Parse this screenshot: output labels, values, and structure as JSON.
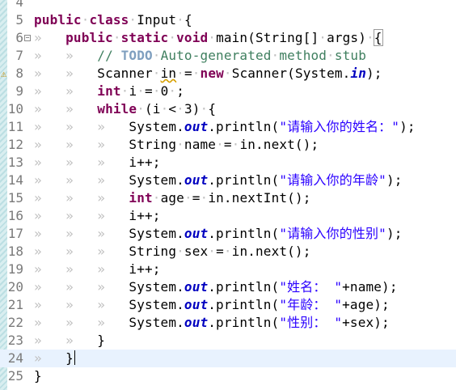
{
  "editor": {
    "lines": [
      {
        "num": "4",
        "code": ""
      },
      {
        "num": "5",
        "code": "public class Input {"
      },
      {
        "num": "6",
        "code": "    public static void main(String[] args) {"
      },
      {
        "num": "7",
        "code": "        // TODO Auto-generated method stub"
      },
      {
        "num": "8",
        "code": "        Scanner in = new Scanner(System.in);"
      },
      {
        "num": "9",
        "code": "        int i = 0 ;"
      },
      {
        "num": "10",
        "code": "        while (i < 3) {"
      },
      {
        "num": "11",
        "code": "            System.out.println(\"请输入你的姓名：\");"
      },
      {
        "num": "12",
        "code": "            String name = in.next();"
      },
      {
        "num": "13",
        "code": "            i++;"
      },
      {
        "num": "14",
        "code": "            System.out.println(\"请输入你的年龄\");"
      },
      {
        "num": "15",
        "code": "            int age = in.nextInt();"
      },
      {
        "num": "16",
        "code": "            i++;"
      },
      {
        "num": "17",
        "code": "            System.out.println(\"请输入你的性别\");"
      },
      {
        "num": "18",
        "code": "            String sex = in.next();"
      },
      {
        "num": "19",
        "code": "            i++;"
      },
      {
        "num": "20",
        "code": "            System.out.println(\"姓名： \"+name);"
      },
      {
        "num": "21",
        "code": "            System.out.println(\"年龄： \"+age);"
      },
      {
        "num": "22",
        "code": "            System.out.println(\"性别： \"+sex);"
      },
      {
        "num": "23",
        "code": "        }"
      },
      {
        "num": "24",
        "code": "    }"
      },
      {
        "num": "25",
        "code": "}"
      }
    ],
    "current_line": "24",
    "fold_marker_line": "6",
    "warning_line": "8",
    "colors": {
      "keyword": "#7f0055",
      "comment": "#3f7f5f",
      "todo": "#7f9fbf",
      "string": "#2a00ff",
      "field": "#0000c0",
      "current_line_bg": "#e8f2fe"
    },
    "icons": {
      "fold": "fold-collapse-icon",
      "warning": "warning-icon",
      "override": "override-marker-icon"
    }
  }
}
